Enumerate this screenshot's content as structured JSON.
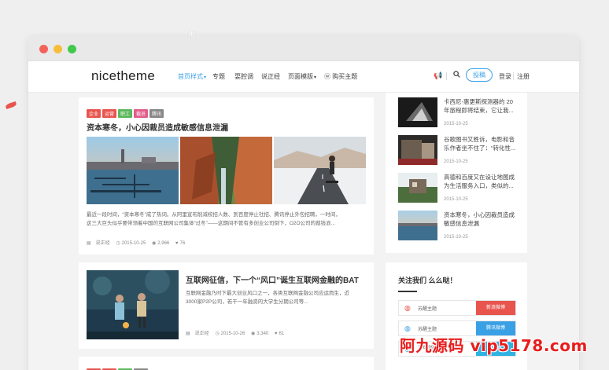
{
  "brand": {
    "logo": "nicetheme"
  },
  "nav": {
    "items": [
      {
        "label": "首页样式",
        "active": true,
        "dropdown": true
      },
      {
        "label": "专题",
        "active": false,
        "dropdown": false
      },
      {
        "label": "耍腔调",
        "active": false,
        "dropdown": false
      },
      {
        "label": "说正经",
        "active": false,
        "dropdown": false
      },
      {
        "label": "页面模版",
        "active": false,
        "dropdown": true
      },
      {
        "label": "购买主题",
        "active": false,
        "dropdown": false
      }
    ],
    "post_button": "投稿",
    "login": "登录",
    "register": "注册",
    "accent_color": "#3aa0e6"
  },
  "posts": [
    {
      "tags": [
        {
          "label": "企业",
          "color": "#e8554e"
        },
        {
          "label": "运营",
          "color": "#e8554e"
        },
        {
          "label": "职工",
          "color": "#5cb85c"
        },
        {
          "label": "裁员",
          "color": "#e35d8b"
        },
        {
          "label": "腾讯",
          "color": "#888888"
        }
      ],
      "title": "资本寒冬，小心因裁员造成敏感信息泄漏",
      "excerpt_lines": [
        "最近一段时间，“资本寒冬”成了热词。从阿里宣布削减校招人数、到百度停止社招、腾讯停止外包招聘，一时间，",
        "这三大巨头似乎要带领着中国的互联网公司集体“过冬”——这期间不管有多创业公司倒下，O2O公司的裁钱浪..."
      ],
      "author": "说正经",
      "date": "2015-10-25",
      "views": "2,966",
      "likes": "76"
    },
    {
      "tags": [],
      "title": "互联网征信，下一个“风口”诞生互联网金融的BAT",
      "excerpt_lines": [
        "互联网金融乃时下最大创业风口之一，各类互联网金融公司应运而生，近",
        "3000家P2P公司，若干一年融资的大学生分期公司等..."
      ],
      "author": "说正经",
      "date": "2015-10-26",
      "views": "3,340",
      "likes": "61"
    }
  ],
  "third_post_tags": [
    {
      "label": "企业",
      "color": "#e8554e"
    },
    {
      "label": "运营",
      "color": "#e8554e"
    },
    {
      "label": "职工",
      "color": "#5cb85c"
    },
    {
      "label": "腾讯",
      "color": "#888888"
    }
  ],
  "sidebar": {
    "recent": [
      {
        "title_lines": [
          "卡西尼-惠更斯探测器的 20",
          "年旅程即将结束，它让我..."
        ],
        "date": "2015-10-25"
      },
      {
        "title_lines": [
          "谷歌图书又胜诉，电影和音",
          "乐作者坐不住了：“转化性..."
        ],
        "date": "2015-10-25"
      },
      {
        "title_lines": [
          "高德和百度又在设让地图成",
          "为生活服务入口，类似的..."
        ],
        "date": "2015-10-25"
      },
      {
        "title_lines": [
          "资本寒冬，小心因裁员造成",
          "敏感信息泄漏"
        ],
        "date": "2015-10-25"
      }
    ],
    "follow": {
      "title": "关注我们 么么哒！",
      "rows": [
        {
          "name": "苏醒主题",
          "button": "新浪微博",
          "button_color": "#e8554e",
          "icon": "weibo-icon"
        },
        {
          "name": "苏醒主题",
          "button": "腾讯微博",
          "button_color": "#3aa0e6",
          "icon": "tencent-weibo-icon"
        },
        {
          "name": "25679993",
          "button": "QQ群",
          "button_color": "#2fb3e3",
          "icon": "qq-icon"
        }
      ]
    }
  },
  "watermark": "阿九源码 vip5178.com"
}
